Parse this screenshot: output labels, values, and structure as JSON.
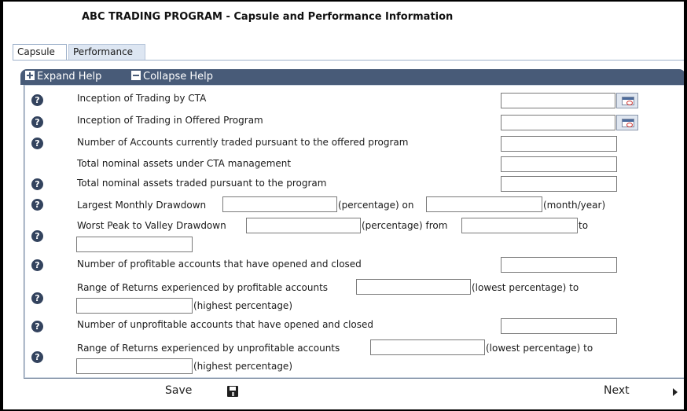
{
  "page": {
    "title": "ABC TRADING PROGRAM - Capsule and Performance Information"
  },
  "tabs": [
    {
      "label": "Capsule",
      "active": true
    },
    {
      "label": "Performance",
      "active": false
    }
  ],
  "help": {
    "expand_label": "Expand Help",
    "collapse_label": "Collapse Help"
  },
  "icons": {
    "help": "?",
    "help_icon": "question-circle-icon",
    "calendar_icon": "calendar-icon",
    "save_icon": "floppy-disk-icon",
    "next_icon": "chevron-right-icon"
  },
  "colors": {
    "header_bar": "#485b78",
    "help_icon": "#33435e",
    "active_tab": "#ffffff",
    "inactive_tab": "#dde6f2"
  },
  "fields": {
    "inception_cta": {
      "label": "Inception of Trading by CTA",
      "value": ""
    },
    "inception_program": {
      "label": "Inception of Trading in Offered Program",
      "value": ""
    },
    "num_accounts": {
      "label": "Number of Accounts currently traded pursuant to the offered program",
      "value": ""
    },
    "total_assets_cta": {
      "label": "Total nominal assets under CTA management",
      "value": ""
    },
    "total_assets_program": {
      "label": "Total nominal assets traded pursuant to the program",
      "value": ""
    },
    "largest_drawdown": {
      "label": "Largest Monthly Drawdown",
      "pct_suffix": "(percentage) on",
      "date_suffix": "(month/year)",
      "pct_value": "",
      "date_value": ""
    },
    "worst_peak_valley": {
      "label": "Worst Peak to Valley Drawdown",
      "pct_suffix": "(percentage) from",
      "to_label": "to",
      "pct_value": "",
      "from_value": "",
      "to_value": ""
    },
    "num_profitable_closed": {
      "label": "Number of profitable accounts that have opened and closed",
      "value": ""
    },
    "range_profitable": {
      "label": "Range of Returns experienced by profitable accounts",
      "low_suffix": "(lowest percentage) to",
      "high_suffix": "(highest percentage)",
      "low_value": "",
      "high_value": ""
    },
    "num_unprofitable_closed": {
      "label": "Number of unprofitable accounts that have opened and closed",
      "value": ""
    },
    "range_unprofitable": {
      "label": "Range of Returns experienced by unprofitable accounts",
      "low_suffix": "(lowest percentage) to",
      "high_suffix": "(highest percentage)",
      "low_value": "",
      "high_value": ""
    }
  },
  "footer": {
    "save_label": "Save",
    "next_label": "Next"
  }
}
